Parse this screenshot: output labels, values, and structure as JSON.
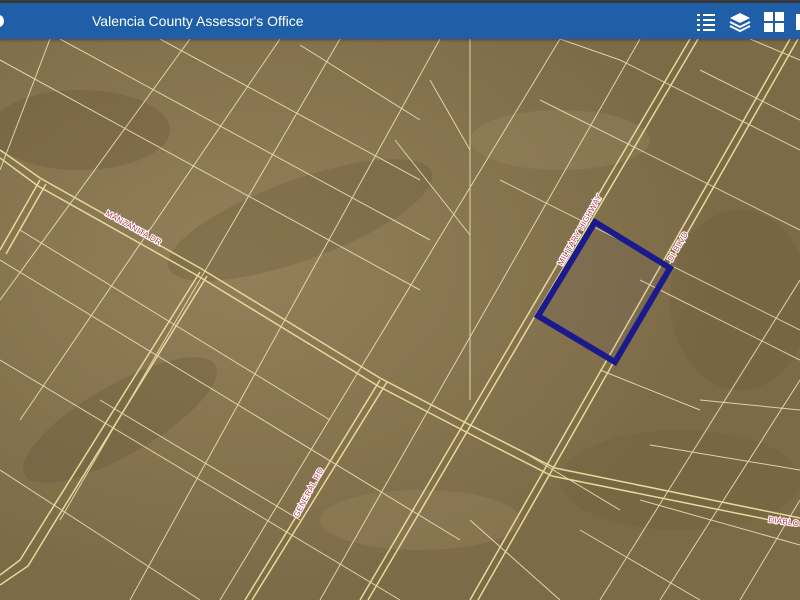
{
  "header": {
    "title": "Valencia County Assessor's Office",
    "tools": [
      {
        "name": "legend-list-icon"
      },
      {
        "name": "layers-icon"
      },
      {
        "name": "basemap-gallery-icon"
      }
    ]
  },
  "map": {
    "labels": {
      "manzanita": "MANZANITA DR",
      "military": "MILITARY HIGHWAY",
      "blvd": "DI BLVD",
      "general": "GENERAL RD",
      "diablo": "DIABLO"
    },
    "colors": {
      "imagery": "#8a7650",
      "parcel_lines": "#f0e6b8",
      "road": "#e8d99a",
      "selected_parcel": "#1a1a8c",
      "header": "#1f5fa8"
    }
  }
}
